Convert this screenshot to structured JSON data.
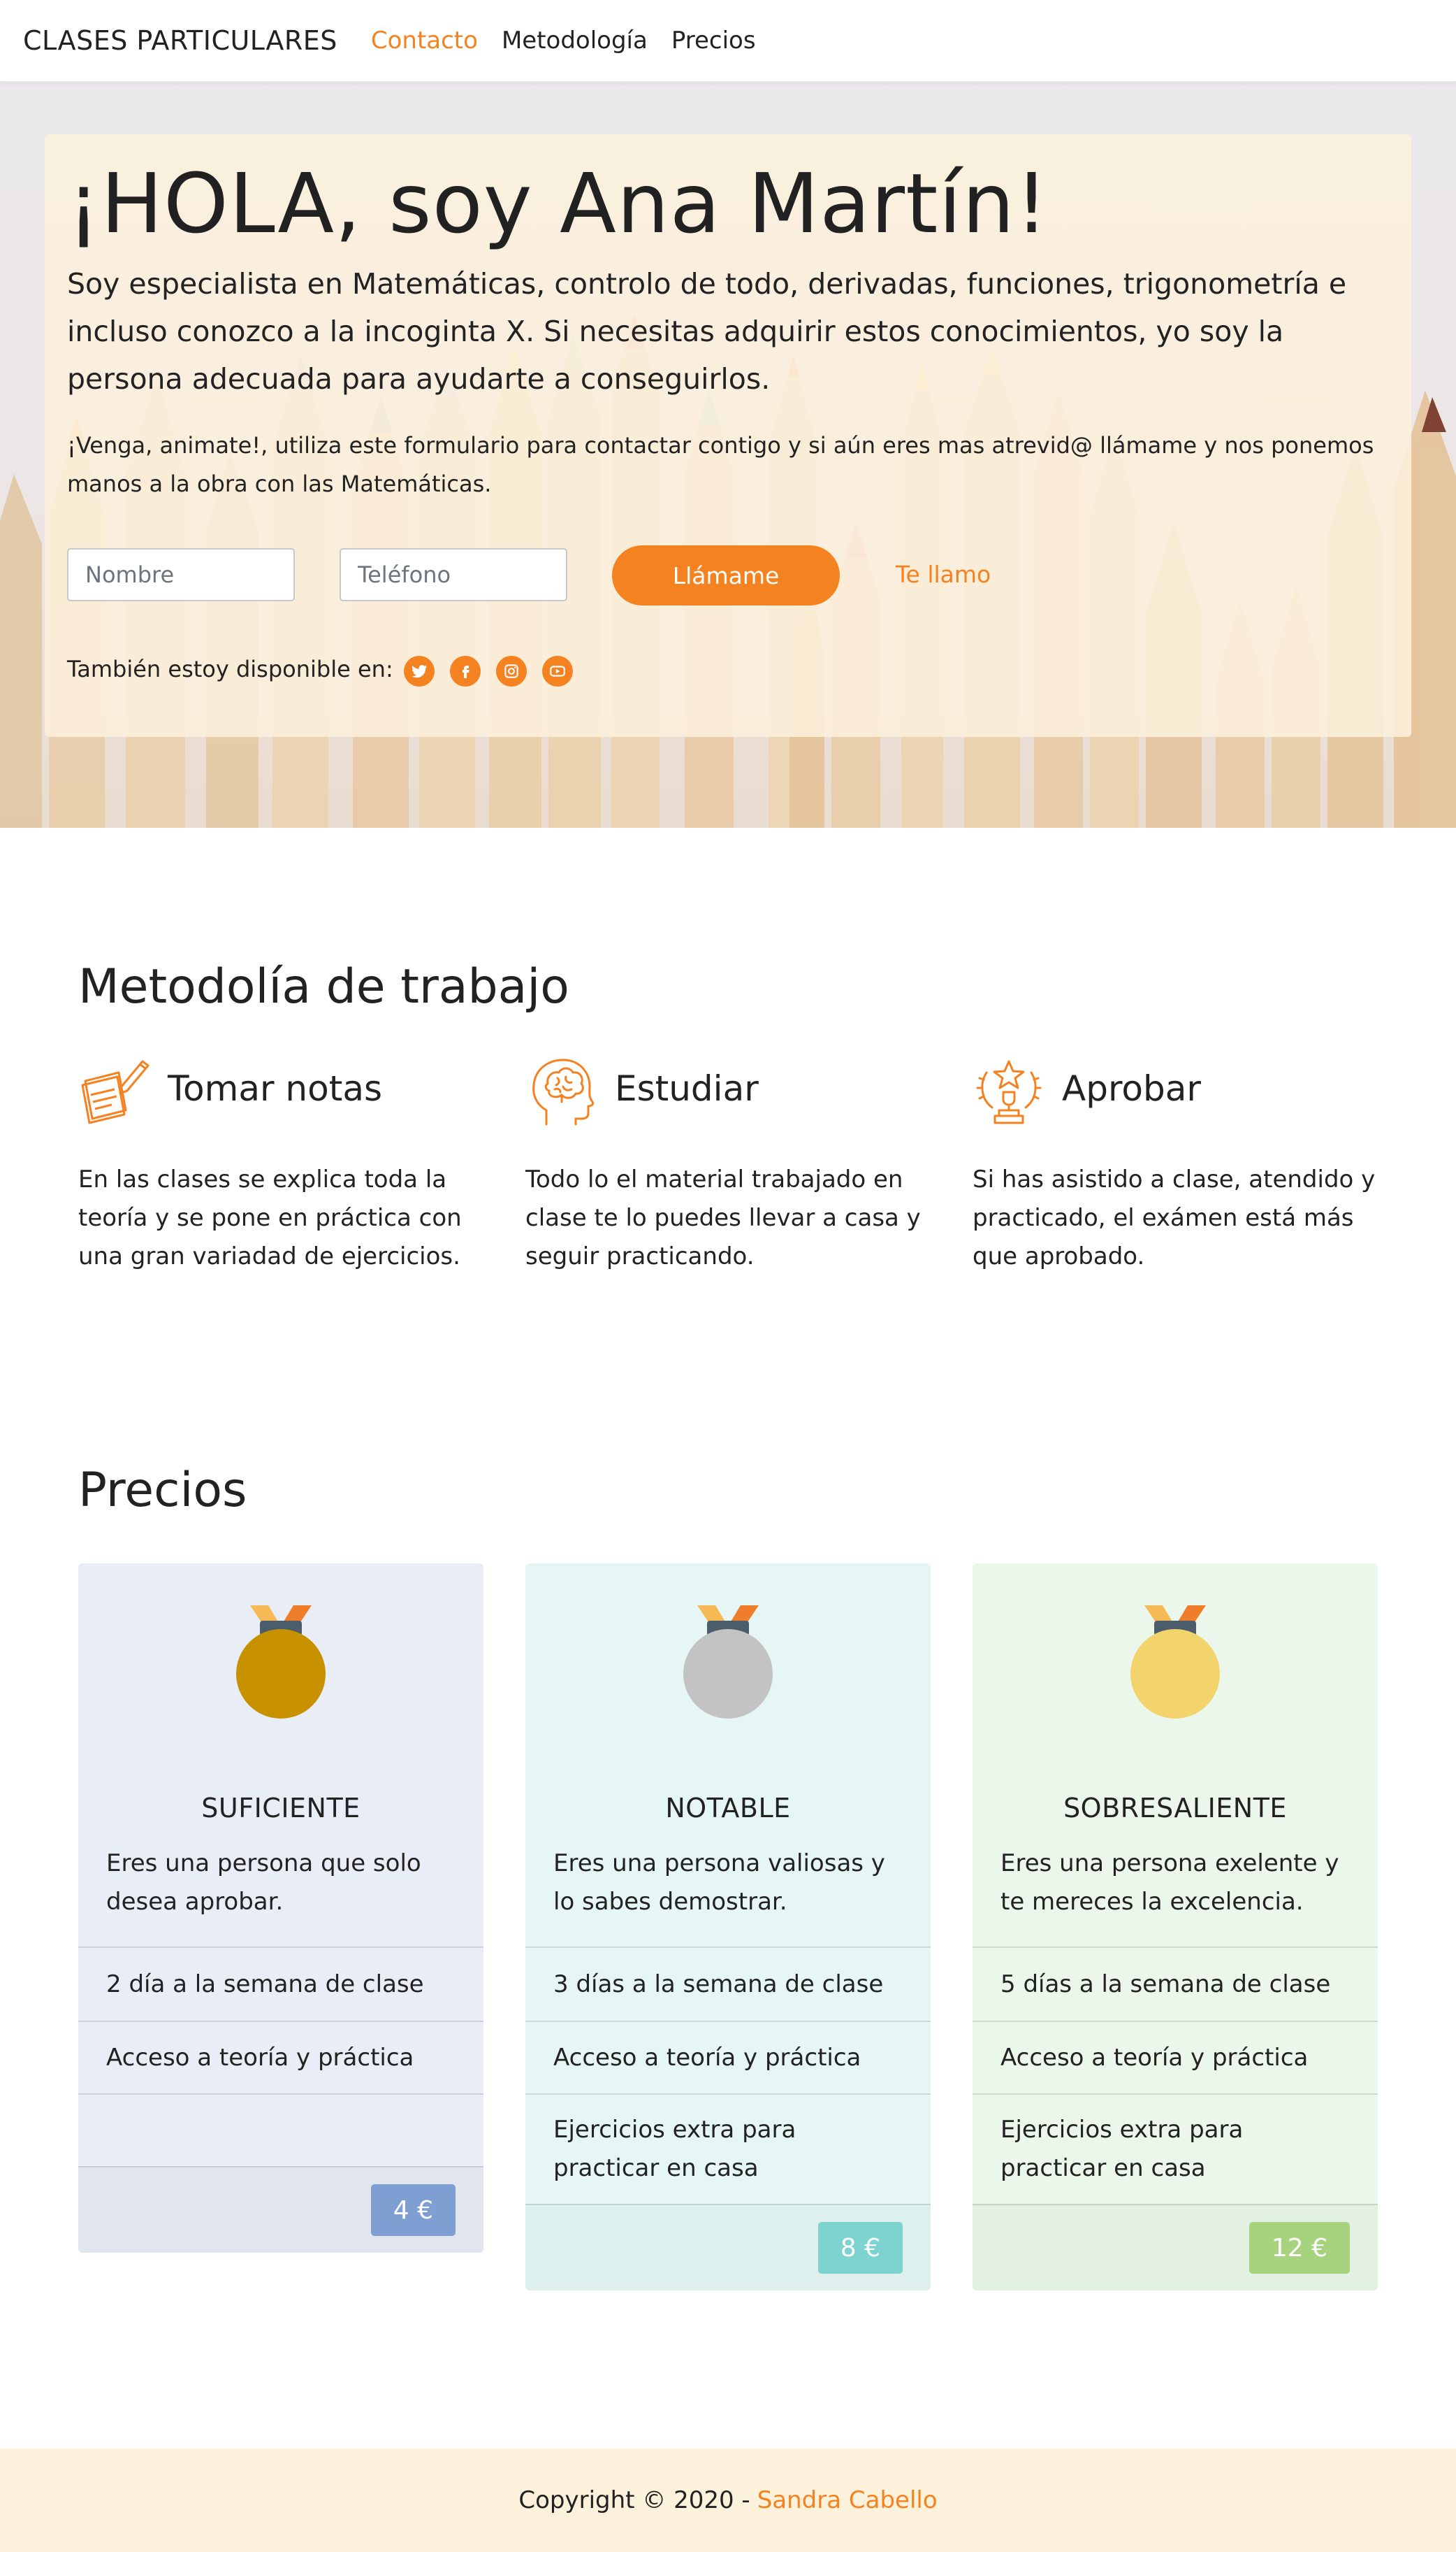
{
  "nav": {
    "brand": "CLASES PARTICULARES",
    "links": [
      {
        "label": "Contacto",
        "active": true
      },
      {
        "label": "Metodología",
        "active": false
      },
      {
        "label": "Precios",
        "active": false
      }
    ]
  },
  "hero": {
    "title": "¡HOLA, soy Ana Martín!",
    "lead": "Soy especialista en Matemáticas, controlo de todo, derivadas, funciones, trigonometría e incluso conozco a la incoginta X. Si necesitas adquirir estos conocimientos, yo soy la persona adecuada para ayudarte a conseguirlos.",
    "text": "¡Venga, animate!, utiliza este formulario para contactar contigo y si aún eres mas atrevid@ llámame y nos ponemos manos a la obra con las Matemáticas.",
    "form": {
      "name_placeholder": "Nombre",
      "phone_placeholder": "Teléfono",
      "call_button": "Llámame",
      "call_link": "Te llamo"
    },
    "social_label": "También estoy disponible en:",
    "social": [
      "twitter-icon",
      "facebook-icon",
      "instagram-icon",
      "youtube-icon"
    ]
  },
  "methodology": {
    "title": "Metodolía de trabajo",
    "items": [
      {
        "icon": "notes-icon",
        "title": "Tomar notas",
        "text": "En las clases se explica toda la teoría y se pone en práctica con una gran variadad de ejercicios."
      },
      {
        "icon": "brain-head-icon",
        "title": "Estudiar",
        "text": "Todo lo el material trabajado en clase te lo puedes llevar a casa y seguir practicando."
      },
      {
        "icon": "trophy-icon",
        "title": "Aprobar",
        "text": "Si has asistido a clase, atendido y practicado, el exámen está más que aprobado."
      }
    ]
  },
  "pricing": {
    "title": "Precios",
    "plans": [
      {
        "name": "SUFICIENTE",
        "description": "Eres una persona que solo desea aprobar.",
        "features": [
          "2 día a la semana de clase",
          "Acceso a teoría y práctica",
          ""
        ],
        "price": "4 €",
        "colors": {
          "card": "#e9eef6",
          "footer": "#e1e6ee",
          "badge": "#7f9fd3",
          "medal": "#c79100"
        }
      },
      {
        "name": "NOTABLE",
        "description": "Eres una persona valiosas y lo sabes demostrar.",
        "features": [
          "3 días a la semana de clase",
          "Acceso a teoría y práctica",
          "Ejercicios extra para practicar en casa"
        ],
        "price": "8 €",
        "colors": {
          "card": "#e6f6f5",
          "footer": "#def0ed",
          "badge": "#7dd3d0",
          "medal": "#c3c3c3"
        }
      },
      {
        "name": "SOBRESALIENTE",
        "description": "Eres una persona exelente y te mereces la excelencia.",
        "features": [
          "5 días a la semana de clase",
          "Acceso a teoría y práctica",
          "Ejercicios extra para practicar en casa"
        ],
        "price": "12 €",
        "colors": {
          "card": "#ebf7eb",
          "footer": "#e2f1e1",
          "badge": "#a7d37f",
          "medal": "#f3d46c"
        }
      }
    ]
  },
  "footer": {
    "copyright": "Copyright © 2020 -",
    "author": "Sandra Cabello"
  },
  "colors": {
    "accent": "#f58220"
  }
}
